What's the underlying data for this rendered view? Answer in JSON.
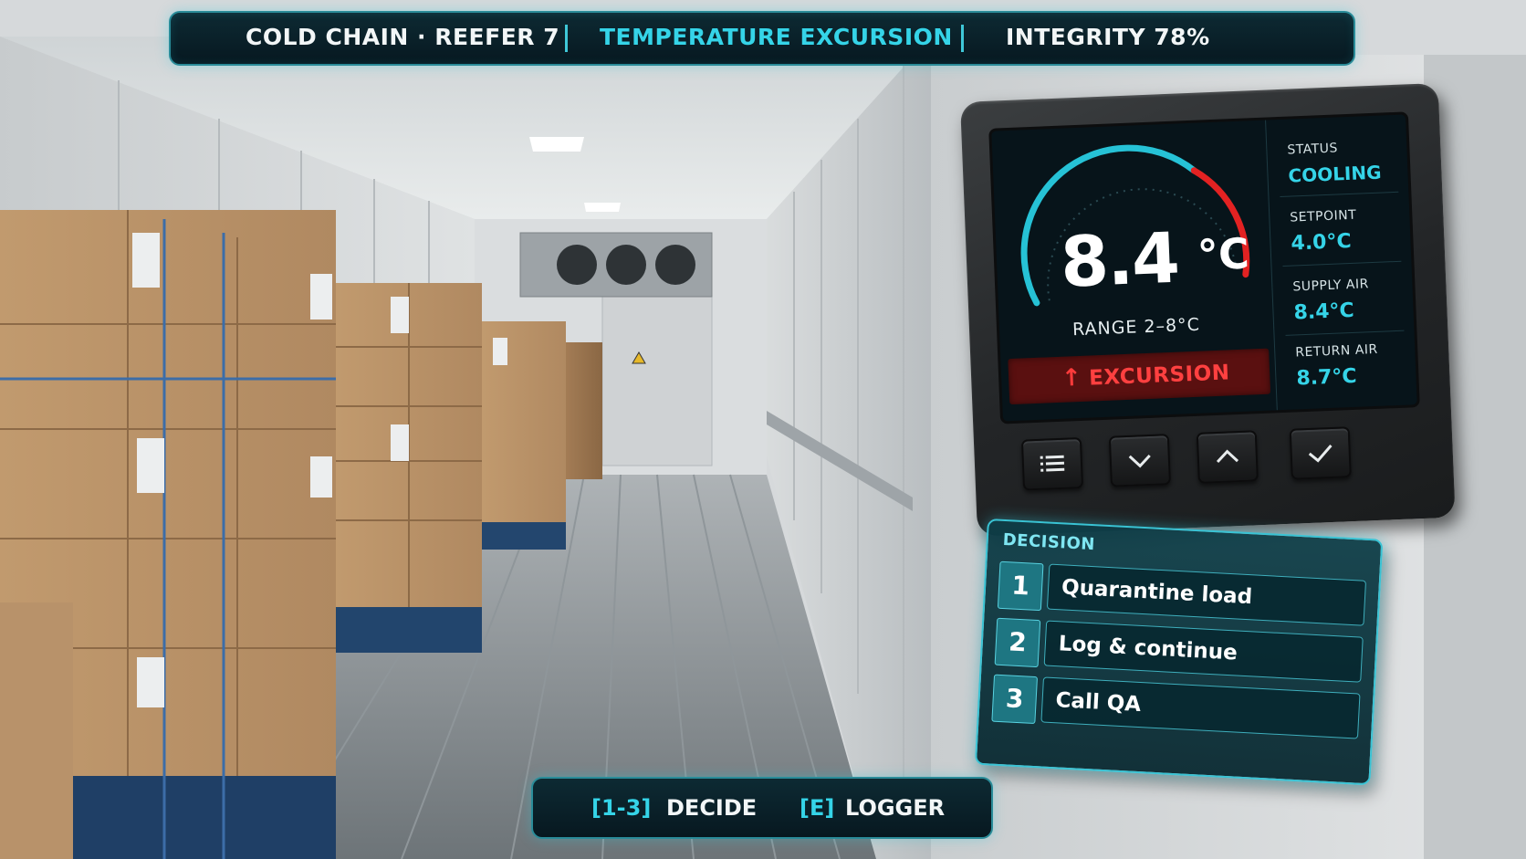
{
  "hud": {
    "context": "COLD CHAIN · REEFER 7",
    "alert": "TEMPERATURE EXCURSION",
    "integrity": "INTEGRITY 78%",
    "integrity_value_percent": 78
  },
  "display": {
    "temperature": "8.4",
    "unit": "°C",
    "range": "RANGE 2–8°C",
    "warning": "EXCURSION",
    "warning_icon": "arrow-up-icon",
    "status_label": "STATUS",
    "status_value": "COOLING",
    "setpoint_label": "SETPOINT",
    "setpoint_value": "4.0°C",
    "supply_label": "SUPPLY AIR",
    "supply_value": "8.4°C",
    "return_label": "RETURN AIR",
    "return_value": "8.7°C",
    "buttons": [
      "menu-icon",
      "chevron-down-icon",
      "chevron-up-icon",
      "check-icon"
    ]
  },
  "decision": {
    "title": "DECISION",
    "options": [
      {
        "key": "1",
        "label": "Quarantine load"
      },
      {
        "key": "2",
        "label": "Log & continue"
      },
      {
        "key": "3",
        "label": "Call QA"
      }
    ]
  },
  "controls": {
    "decide_key": "[1-3]",
    "decide_label": "DECIDE",
    "logger_key": "[E]",
    "logger_label": "LOGGER"
  },
  "colors": {
    "accent": "#35d4e8",
    "alert": "#ff4040",
    "panel": "#0d2a33"
  }
}
